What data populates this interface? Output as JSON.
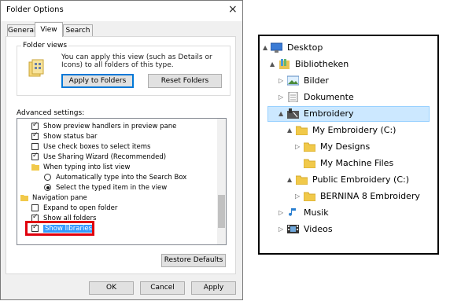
{
  "dialog": {
    "title": "Folder Options",
    "close_glyph": "×",
    "tabs": [
      "General",
      "View",
      "Search"
    ],
    "active_tab": "View",
    "folder_views": {
      "label": "Folder views",
      "description": "You can apply this view (such as Details or Icons) to all folders of this type.",
      "apply_button": "Apply to Folders",
      "reset_button": "Reset Folders"
    },
    "advanced_label": "Advanced settings:",
    "advanced_items": [
      {
        "kind": "checkbox",
        "checked": true,
        "label": "Show preview handlers in preview pane",
        "indent": 1
      },
      {
        "kind": "checkbox",
        "checked": true,
        "label": "Show status bar",
        "indent": 1
      },
      {
        "kind": "checkbox",
        "checked": false,
        "label": "Use check boxes to select items",
        "indent": 1
      },
      {
        "kind": "checkbox",
        "checked": true,
        "label": "Use Sharing Wizard (Recommended)",
        "indent": 1
      },
      {
        "kind": "folder",
        "label": "When typing into list view",
        "indent": 1
      },
      {
        "kind": "radio",
        "checked": false,
        "label": "Automatically type into the Search Box",
        "indent": 2
      },
      {
        "kind": "radio",
        "checked": true,
        "label": "Select the typed item in the view",
        "indent": 2
      },
      {
        "kind": "folder",
        "label": "Navigation pane",
        "indent": 0
      },
      {
        "kind": "checkbox",
        "checked": false,
        "label": "Expand to open folder",
        "indent": 1
      },
      {
        "kind": "checkbox",
        "checked": true,
        "label": "Show all folders",
        "indent": 1
      },
      {
        "kind": "checkbox",
        "checked": true,
        "label": "Show libraries",
        "indent": 1,
        "selected": true
      }
    ],
    "restore_button": "Restore Defaults",
    "ok_button": "OK",
    "cancel_button": "Cancel",
    "apply_button": "Apply",
    "colors": {
      "highlight": "#e0000d",
      "selection": "#3399ff",
      "accent": "#0078d7"
    }
  },
  "explorer": {
    "items": [
      {
        "label": "Desktop",
        "icon": "desktop-icon",
        "arrow": "▲",
        "depth": 0
      },
      {
        "label": "Bibliotheken",
        "icon": "library-icon",
        "arrow": "▲",
        "depth": 1
      },
      {
        "label": "Bilder",
        "icon": "pictures-icon",
        "arrow": "▷",
        "depth": 2
      },
      {
        "label": "Dokumente",
        "icon": "documents-icon",
        "arrow": "▷",
        "depth": 2
      },
      {
        "label": "Embroidery",
        "icon": "embroidery-library-icon",
        "arrow": "▲",
        "depth": 2,
        "selected": true
      },
      {
        "label": "My Embroidery (C:)",
        "icon": "folder-icon",
        "arrow": "▲",
        "depth": 3
      },
      {
        "label": "My Designs",
        "icon": "folder-icon",
        "arrow": "▷",
        "depth": 4
      },
      {
        "label": "My Machine Files",
        "icon": "folder-icon",
        "arrow": "",
        "depth": 4
      },
      {
        "label": "Public Embroidery (C:)",
        "icon": "folder-icon",
        "arrow": "▲",
        "depth": 3
      },
      {
        "label": "BERNINA 8 Embroidery",
        "icon": "folder-icon",
        "arrow": "▷",
        "depth": 4
      },
      {
        "label": "Musik",
        "icon": "music-icon",
        "arrow": "▷",
        "depth": 2
      },
      {
        "label": "Videos",
        "icon": "videos-icon",
        "arrow": "▷",
        "depth": 2
      }
    ]
  }
}
